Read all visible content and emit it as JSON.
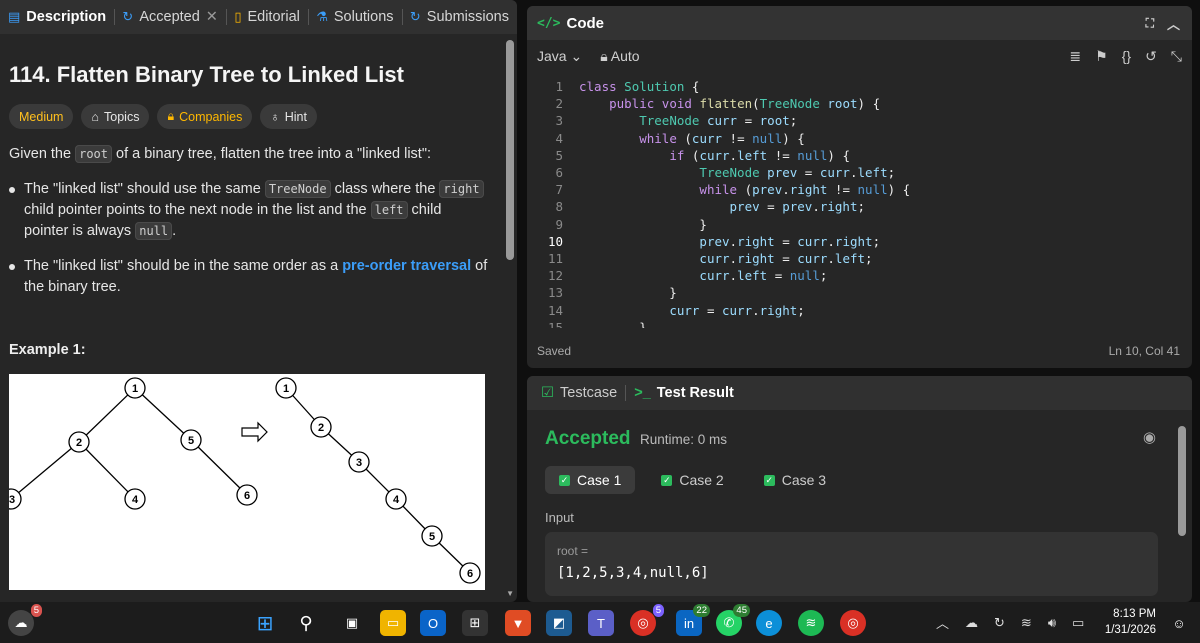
{
  "left_tabs": {
    "description": "Description",
    "accepted": "Accepted",
    "editorial": "Editorial",
    "solutions": "Solutions",
    "submissions": "Submissions"
  },
  "problem": {
    "title": "114. Flatten Binary Tree to Linked List",
    "tags": [
      "Medium",
      "Topics",
      "Companies",
      "Hint"
    ],
    "intro_pre": "Given the ",
    "intro_code": "root",
    "intro_post": " of a binary tree, flatten the tree into a \"linked list\":",
    "b1_a": "The \"linked list\" should use the same ",
    "b1_code1": "TreeNode",
    "b1_b": " class where the ",
    "b1_code2": "right",
    "b1_c": " child pointer points to the next node in the list and the ",
    "b1_code3": "left",
    "b1_d": " child pointer is always ",
    "b1_code4": "null",
    "b1_e": ".",
    "b2_a": "The \"linked list\" should be in the same order as a ",
    "b2_link": "pre-order traversal",
    "b2_b": " of the binary tree.",
    "example_label": "Example 1:"
  },
  "code_panel": {
    "title": "Code",
    "language": "Java",
    "mode": "Auto",
    "saved": "Saved",
    "cursor": "Ln 10, Col 41"
  },
  "code_lines": [
    "class Solution {",
    "    public void flatten(TreeNode root) {",
    "        TreeNode curr = root;",
    "        while (curr != null) {",
    "            if (curr.left != null) {",
    "                TreeNode prev = curr.left;",
    "                while (prev.right != null) {",
    "                    prev = prev.right;",
    "                }",
    "                prev.right = curr.right;",
    "                curr.right = curr.left;",
    "                curr.left = null;",
    "            }",
    "            curr = curr.right;",
    "        }"
  ],
  "result": {
    "tab_testcase": "Testcase",
    "tab_result": "Test Result",
    "status": "Accepted",
    "runtime": "Runtime: 0 ms",
    "cases": [
      "Case 1",
      "Case 2",
      "Case 3"
    ],
    "input_label": "Input",
    "var_label": "root =",
    "value": "[1,2,5,3,4,null,6]"
  },
  "taskbar": {
    "time": "8:13 PM",
    "date": "1/31/2026",
    "badges": {
      "weather": "5",
      "linkedin": "22",
      "whatsapp": "45",
      "teams": "5"
    }
  }
}
